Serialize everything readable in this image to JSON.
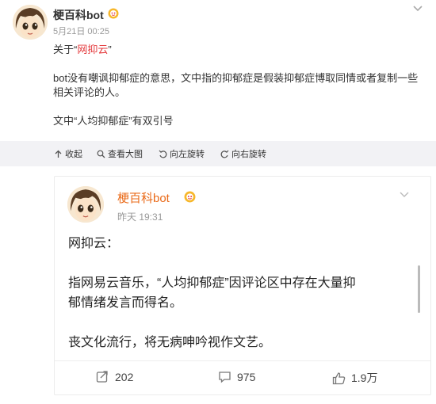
{
  "post": {
    "author": "梗百科bot",
    "time": "5月21日 00:25",
    "line1_prefix": "关于",
    "line1_quote_open": "“",
    "line1_link": "网抑云",
    "line1_quote_close": "”",
    "line2": "bot没有嘲讽抑郁症的意思，文中指的抑郁症是假装抑郁症博取同情或者复制一些",
    "line3": "相关评论的人。",
    "line4": "文中“人均抑郁症”有双引号"
  },
  "media_bar": {
    "collapse": "收起",
    "view_large": "查看大图",
    "rotate_left": "向左旋转",
    "rotate_right": "向右旋转"
  },
  "card": {
    "author": "梗百科bot",
    "time": "昨天 19:31",
    "para1": "网抑云：",
    "para2a": "指网易云音乐，“人均抑郁症”因评论区中存在大量抑",
    "para2b": "郁情绪发言而得名。",
    "para3": "丧文化流行，将无病呻吟视作文艺。",
    "repost_count": "202",
    "comment_count": "975",
    "like_count": "1.9万"
  },
  "colors": {
    "link_red": "#e4393c",
    "card_name_orange": "#ea6a18",
    "bar_bg": "#f2f2f5"
  },
  "icons": [
    "avatar",
    "verified-badge-icon",
    "chevron-down-icon",
    "collapse-arrow-icon",
    "search-icon",
    "rotate-left-icon",
    "rotate-right-icon",
    "repost-icon",
    "comment-icon",
    "like-icon"
  ]
}
